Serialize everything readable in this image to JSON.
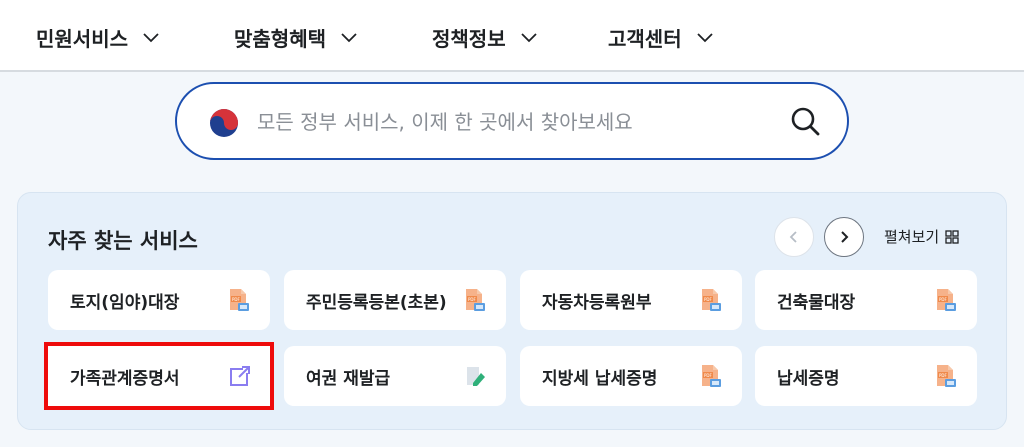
{
  "nav": {
    "items": [
      {
        "label": "민원서비스"
      },
      {
        "label": "맞춤형혜택"
      },
      {
        "label": "정책정보"
      },
      {
        "label": "고객센터"
      }
    ]
  },
  "search": {
    "placeholder": "모든 정부 서비스, 이제 한 곳에서 찾아보세요"
  },
  "quick": {
    "title": "자주 찾는 서비스",
    "expand_label": "펼쳐보기",
    "items": [
      {
        "label": "토지(임야)대장",
        "icon": "pdf-doc-icon"
      },
      {
        "label": "주민등록등본(초본)",
        "icon": "pdf-doc-icon"
      },
      {
        "label": "자동차등록원부",
        "icon": "pdf-doc-icon"
      },
      {
        "label": "건축물대장",
        "icon": "pdf-doc-icon"
      },
      {
        "label": "가족관계증명서",
        "icon": "external-link-icon"
      },
      {
        "label": "여권 재발급",
        "icon": "edit-doc-icon"
      },
      {
        "label": "지방세 납세증명",
        "icon": "pdf-doc-icon"
      },
      {
        "label": "납세증명",
        "icon": "pdf-doc-icon"
      }
    ]
  },
  "colors": {
    "accent": "#1c4fb0",
    "highlight": "#ee0b0b",
    "panel_bg": "#e6f0fa",
    "pdf_orange": "#f08a4b"
  }
}
